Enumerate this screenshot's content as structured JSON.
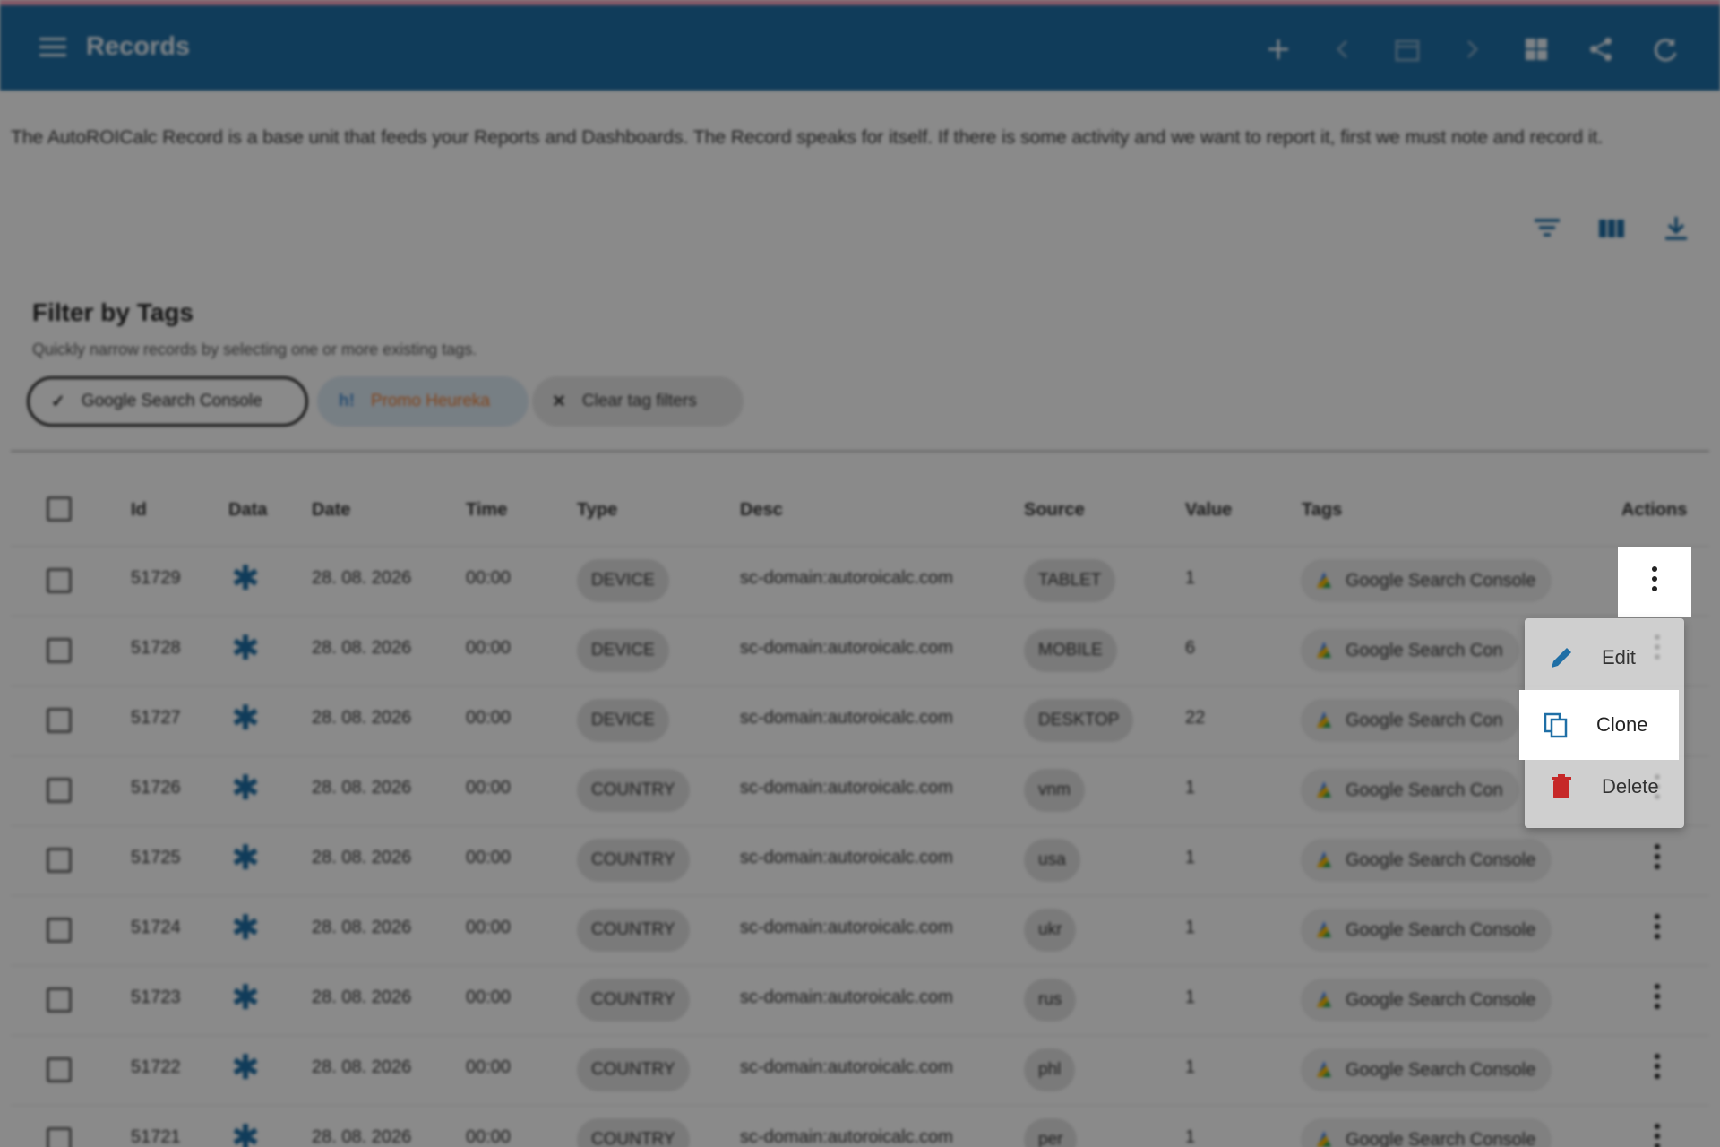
{
  "colors": {
    "app_bar": "#1f6fa6",
    "accent": "#1f6fa6",
    "promo_tag_text": "#f07a2c",
    "delete_icon": "#c62828"
  },
  "app": {
    "title": "Records",
    "toolbar_icons": [
      "add-icon",
      "chevron-left-icon",
      "calendar-icon",
      "chevron-right-icon",
      "dashboard-icon",
      "share-icon",
      "refresh-icon"
    ]
  },
  "intro_text": "The AutoROICalc Record is a base unit that feeds your Reports and Dashboards. The Record speaks for itself. If there is some activity and we want to report it, first we must note and record it.",
  "table_tools": [
    "filter-icon",
    "columns-icon",
    "download-icon"
  ],
  "filter": {
    "title": "Filter by Tags",
    "subtitle": "Quickly narrow records by selecting one or more existing tags.",
    "chips": {
      "selected": "Google Search Console",
      "promo": "Promo Heureka",
      "promo_prefix": "h!",
      "clear": "Clear tag filters"
    }
  },
  "table": {
    "headers": [
      "Id",
      "Data",
      "Date",
      "Time",
      "Type",
      "Desc",
      "Source",
      "Value",
      "Tags",
      "Actions"
    ],
    "rows": [
      {
        "id": "51729",
        "date": "28. 08. 2026",
        "time": "00:00",
        "type": "DEVICE",
        "desc": "sc-domain:autoroicalc.com",
        "source": "TABLET",
        "value": "1",
        "tag": "Google Search Console"
      },
      {
        "id": "51728",
        "date": "28. 08. 2026",
        "time": "00:00",
        "type": "DEVICE",
        "desc": "sc-domain:autoroicalc.com",
        "source": "MOBILE",
        "value": "6",
        "tag": "Google Search Con"
      },
      {
        "id": "51727",
        "date": "28. 08. 2026",
        "time": "00:00",
        "type": "DEVICE",
        "desc": "sc-domain:autoroicalc.com",
        "source": "DESKTOP",
        "value": "22",
        "tag": "Google Search Con"
      },
      {
        "id": "51726",
        "date": "28. 08. 2026",
        "time": "00:00",
        "type": "COUNTRY",
        "desc": "sc-domain:autoroicalc.com",
        "source": "vnm",
        "value": "1",
        "tag": "Google Search Con"
      },
      {
        "id": "51725",
        "date": "28. 08. 2026",
        "time": "00:00",
        "type": "COUNTRY",
        "desc": "sc-domain:autoroicalc.com",
        "source": "usa",
        "value": "1",
        "tag": "Google Search Console"
      },
      {
        "id": "51724",
        "date": "28. 08. 2026",
        "time": "00:00",
        "type": "COUNTRY",
        "desc": "sc-domain:autoroicalc.com",
        "source": "ukr",
        "value": "1",
        "tag": "Google Search Console"
      },
      {
        "id": "51723",
        "date": "28. 08. 2026",
        "time": "00:00",
        "type": "COUNTRY",
        "desc": "sc-domain:autoroicalc.com",
        "source": "rus",
        "value": "1",
        "tag": "Google Search Console"
      },
      {
        "id": "51722",
        "date": "28. 08. 2026",
        "time": "00:00",
        "type": "COUNTRY",
        "desc": "sc-domain:autoroicalc.com",
        "source": "phl",
        "value": "1",
        "tag": "Google Search Console"
      },
      {
        "id": "51721",
        "date": "28. 08. 2026",
        "time": "00:00",
        "type": "COUNTRY",
        "desc": "sc-domain:autoroicalc.com",
        "source": "per",
        "value": "1",
        "tag": "Google Search Console"
      }
    ]
  },
  "context_menu": {
    "items": [
      {
        "label": "Edit",
        "icon": "pencil-icon"
      },
      {
        "label": "Clone",
        "icon": "copy-icon"
      },
      {
        "label": "Delete",
        "icon": "trash-icon"
      }
    ]
  }
}
